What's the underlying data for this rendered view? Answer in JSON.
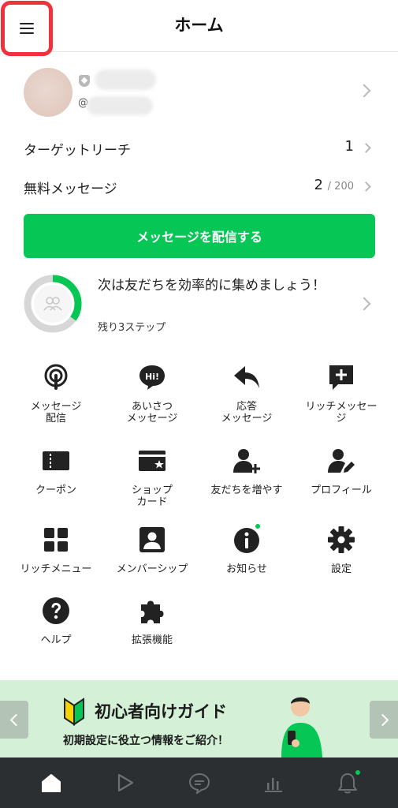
{
  "header": {
    "title": "ホーム",
    "menu_icon": "hamburger-menu-icon",
    "highlight_color": "#f0323c"
  },
  "account": {
    "at_prefix": "@"
  },
  "stats": [
    {
      "label": "ターゲットリーチ",
      "value": "1",
      "suffix": ""
    },
    {
      "label": "無料メッセージ",
      "value": "2",
      "suffix": "/ 200"
    }
  ],
  "cta": {
    "label": "メッセージを配信する",
    "color": "#06c755"
  },
  "onboarding": {
    "message": "次は友だちを効率的に集めましょう！",
    "sub": "残り3ステップ",
    "progress_fraction": 0.35
  },
  "features": [
    {
      "label": "メッセージ\n配信",
      "icon": "broadcast-icon"
    },
    {
      "label": "あいさつ\nメッセージ",
      "icon": "hi-bubble-icon"
    },
    {
      "label": "応答\nメッセージ",
      "icon": "reply-arrow-icon"
    },
    {
      "label": "リッチメッセー\nジ",
      "icon": "plus-bubble-icon"
    },
    {
      "label": "クーポン",
      "icon": "coupon-icon"
    },
    {
      "label": "ショップ\nカード",
      "icon": "shop-card-icon"
    },
    {
      "label": "友だちを増やす",
      "icon": "add-friend-icon"
    },
    {
      "label": "プロフィール",
      "icon": "profile-edit-icon"
    },
    {
      "label": "リッチメニュー",
      "icon": "grid-menu-icon"
    },
    {
      "label": "メンバーシップ",
      "icon": "member-card-icon"
    },
    {
      "label": "お知らせ",
      "icon": "info-icon"
    },
    {
      "label": "設定",
      "icon": "gear-icon"
    },
    {
      "label": "ヘルプ",
      "icon": "help-icon"
    },
    {
      "label": "拡張機能",
      "icon": "puzzle-icon"
    }
  ],
  "banner": {
    "title": "初心者向けガイド",
    "subtitle": "初期設定に役立つ情報をご紹介！",
    "bg": "#d4f0d6"
  },
  "tabbar": {
    "tabs": [
      "home-tab-icon",
      "play-tab-icon",
      "chat-tab-icon",
      "insights-tab-icon",
      "notifications-tab-icon"
    ],
    "bg": "#2c2f32"
  }
}
